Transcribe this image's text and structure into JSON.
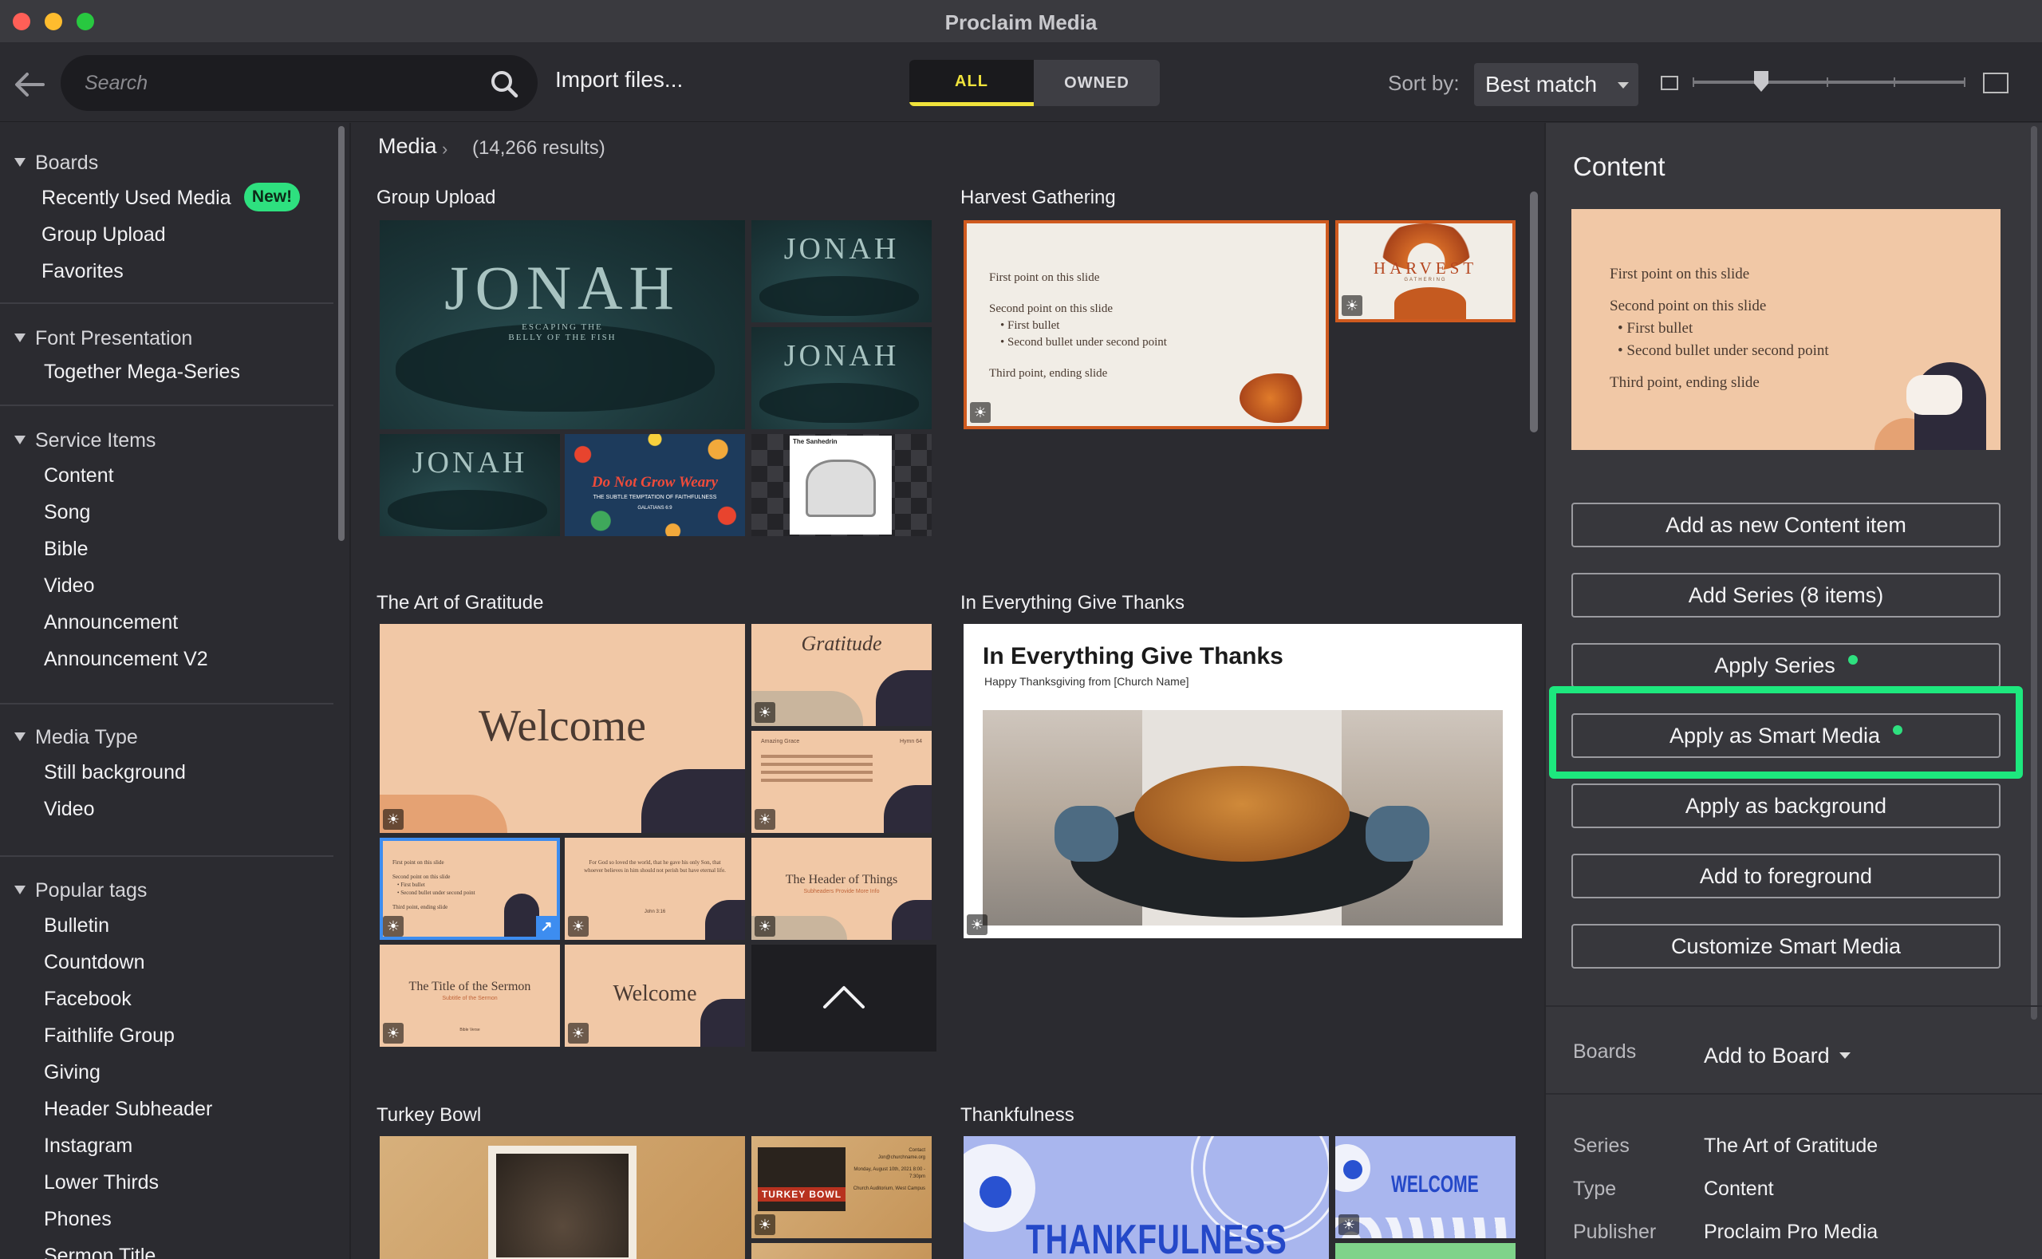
{
  "window": {
    "title": "Proclaim Media"
  },
  "toolbar": {
    "search_placeholder": "Search",
    "import_label": "Import files...",
    "filter_all": "ALL",
    "filter_owned": "OWNED",
    "sort_label": "Sort by:",
    "sort_value": "Best match"
  },
  "sidebar": {
    "sections": [
      {
        "title": "Boards",
        "items": [
          "Recently Used Media",
          "Group Upload",
          "Favorites"
        ],
        "badge": "New!"
      },
      {
        "title": "Font Presentation",
        "items": [
          "Together Mega-Series"
        ]
      },
      {
        "title": "Service Items",
        "items": [
          "Content",
          "Song",
          "Bible",
          "Video",
          "Announcement",
          "Announcement V2"
        ]
      },
      {
        "title": "Media Type",
        "items": [
          "Still background",
          "Video"
        ]
      },
      {
        "title": "Popular tags",
        "items": [
          "Bulletin",
          "Countdown",
          "Facebook",
          "Faithlife Group",
          "Giving",
          "Header Subheader",
          "Instagram",
          "Lower Thirds",
          "Phones",
          "Sermon Title"
        ]
      }
    ]
  },
  "main": {
    "breadcrumb": "Media",
    "results": "(14,266 results)",
    "groups": [
      {
        "title": "Group Upload"
      },
      {
        "title": "Harvest Gathering"
      },
      {
        "title": "The Art of Gratitude"
      },
      {
        "title": "In Everything Give Thanks"
      },
      {
        "title": "Turkey Bowl"
      },
      {
        "title": "Thankfulness"
      }
    ],
    "thumbs": {
      "jonah": "JONAH",
      "jonah_sub": "ESCAPING THE\nBELLY OF THE FISH",
      "grow_weary": "Do Not Grow Weary",
      "grow_weary_sub": "THE SUBTLE TEMPTATION OF FAITHFULNESS",
      "grow_weary_ref": "GALATIANS 6:9",
      "sanhedrin": "The Sanhedrin",
      "harvest": "HARVEST",
      "harvest_sub": "GATHERING",
      "slide_line1": "First point on this slide",
      "slide_line2": "Second point on this slide",
      "slide_bullet1": "First bullet",
      "slide_bullet2": "Second bullet under second point",
      "slide_line3": "Third point, ending slide",
      "welcome": "Welcome",
      "gratitude": "Gratitude",
      "amazing": "Amazing Grace",
      "hymn": "Hymn 64",
      "john": "For God so loved the world, that he gave his only Son, that whoever believes in him should not perish but have eternal life.",
      "john_ref": "John 3:16",
      "header_things": "The Header of Things",
      "header_sub": "Subheaders Provide More Info",
      "sermon_title": "The Title of the Sermon",
      "sermon_sub": "Subtitle of the Sermon",
      "bible_verse": "Bible Verse",
      "thanks_title": "In Everything Give Thanks",
      "thanks_sub": "Happy Thanksgiving from [Church Name]",
      "turkey_bowl": "TURKEY BOWL",
      "thankfulness": "THANKFULNESS",
      "welcome_caps": "WELCOME",
      "contact": "Contact",
      "email": "Jon@churchname.org",
      "event_date": "Monday, August 10th, 2021 8:00 - 7:30pm",
      "event_place": "Church Auditorium, West Campus"
    }
  },
  "panel": {
    "title": "Content",
    "preview": {
      "line1": "First point on this slide",
      "line2": "Second point on this slide",
      "bullet1": "First bullet",
      "bullet2": "Second bullet under second point",
      "line3": "Third point, ending slide"
    },
    "buttons": [
      "Add as new Content item",
      "Add Series (8 items)",
      "Apply Series",
      "Apply as Smart Media",
      "Apply as background",
      "Add to foreground",
      "Customize Smart Media"
    ],
    "boards_label": "Boards",
    "add_to_board": "Add to Board",
    "meta": [
      {
        "label": "Series",
        "value": "The Art of Gratitude"
      },
      {
        "label": "Type",
        "value": "Content"
      },
      {
        "label": "Publisher",
        "value": "Proclaim Pro Media"
      }
    ]
  },
  "colors": {
    "accent_yellow": "#f0e33c",
    "new_badge": "#2ee07f",
    "highlight": "#1de87e"
  }
}
